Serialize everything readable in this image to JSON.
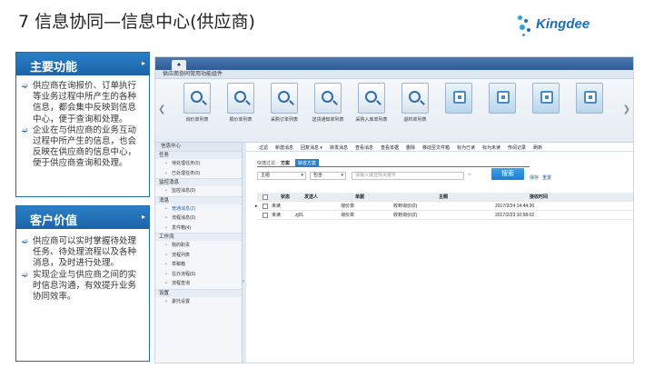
{
  "slide_title": "7 信息协同—信息中心(供应商)",
  "logo_text": "Kingdee",
  "panels": [
    {
      "title": "主要功能",
      "bullets": [
        [
          "供应商在询报价、订单执行",
          "等业务过程中所产生的各种",
          "信息，都会集中反映到信息",
          "中心，便于查询和处理。"
        ],
        [
          "企业在与供应商的业务互动",
          "过程中所产生的信息，也会",
          "反映在供应商的信息中心，",
          "便于供应商查询和处理。"
        ]
      ]
    },
    {
      "title": "客户价值",
      "bullets": [
        [
          "供应商可以实时掌握待处理",
          "任务、待处理流程以及各种",
          "消息，及时进行处理。"
        ],
        [
          "实现企业与供应商之间的实",
          "时信息沟通，有效提升业务",
          "协同效率。"
        ]
      ]
    }
  ],
  "app": {
    "home_tab": "♠",
    "section_title": "供应商协同常用功能组件",
    "tiles": [
      {
        "label": "询价单列表",
        "icon": "magnifier-icon"
      },
      {
        "label": "报价单列表",
        "icon": "magnifier-icon"
      },
      {
        "label": "采购订单列表",
        "icon": "magnifier-icon"
      },
      {
        "label": "送货通知单列表",
        "icon": "magnifier-icon"
      },
      {
        "label": "采购入库单列表",
        "icon": "magnifier-icon"
      },
      {
        "label": "退料单列表",
        "icon": "magnifier-icon"
      },
      {
        "label": "",
        "icon": "document-icon"
      },
      {
        "label": "",
        "icon": "document-icon"
      },
      {
        "label": "",
        "icon": "document-icon"
      },
      {
        "label": "",
        "icon": "document-icon"
      }
    ],
    "info_center_title": "信息中心",
    "nav": [
      {
        "group": "任务",
        "items": [
          "待处理任务(0)",
          "已处理任务(0)"
        ]
      },
      {
        "group": "监控消息",
        "items": [
          "监控消息(0)"
        ]
      },
      {
        "group": "消息",
        "items": [
          "普通消息(2)",
          "流程消息(0)",
          "发件箱(4)"
        ],
        "active": 0
      },
      {
        "group": "工作流",
        "items": [
          "我的职责",
          "流程列表",
          "草稿箱",
          "在办流程(0)",
          "流程查询"
        ]
      },
      {
        "group": "设置",
        "items": [
          "委托设置"
        ]
      }
    ],
    "toolbar": [
      "过滤",
      "新建消息",
      "回复消息 ▾",
      "转发消息",
      "查看消息",
      "查看单据",
      "删除",
      "移动至文件箱",
      "标为已读",
      "标为未读",
      "传阅记录",
      "刷新"
    ],
    "scheme_label": "快捷过滤",
    "scheme_name": "方案",
    "scheme_button": "缺省方案",
    "filter": {
      "field": "主题",
      "op": "包含",
      "placeholder": "请输入或选择关键字"
    },
    "search_button": "搜索",
    "links": [
      "保存",
      "重置"
    ],
    "table": {
      "headers": [
        "状态",
        "发送人",
        "单据",
        "主题",
        "接收时间"
      ],
      "rows": [
        [
          "未读",
          "",
          "询价单",
          "收到询价(0)",
          "2017/2/24 14:44:30"
        ],
        [
          "未读",
          "zj01",
          "询价单",
          "收到询价(0)",
          "2017/2/23 10:58:02"
        ]
      ]
    }
  }
}
